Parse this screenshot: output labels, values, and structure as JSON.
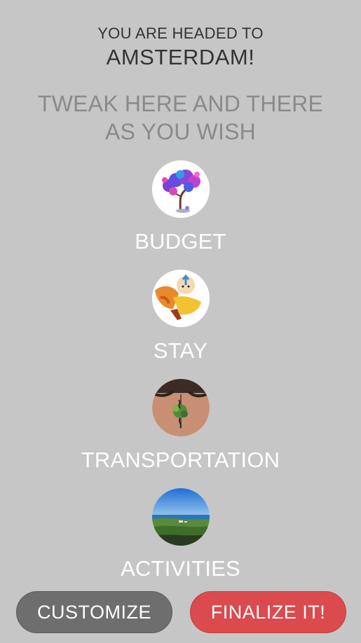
{
  "header": {
    "headed_text": "YOU ARE HEADED TO",
    "destination": "AMSTERDAM!"
  },
  "subtitle": {
    "line1": "TWEAK HERE AND THERE",
    "line2": "AS YOU WISH"
  },
  "options": [
    {
      "label": "BUDGET",
      "icon": "purple-tree-icon"
    },
    {
      "label": "STAY",
      "icon": "monk-character-icon"
    },
    {
      "label": "TRANSPORTATION",
      "icon": "back-tattoo-icon"
    },
    {
      "label": "ACTIVITIES",
      "icon": "landscape-photo-icon"
    }
  ],
  "buttons": {
    "customize": "CUSTOMIZE",
    "finalize": "FINALIZE IT!"
  },
  "colors": {
    "background": "#c6c6c6",
    "customize_button": "#6e6e6e",
    "finalize_button": "#db4a4d"
  }
}
